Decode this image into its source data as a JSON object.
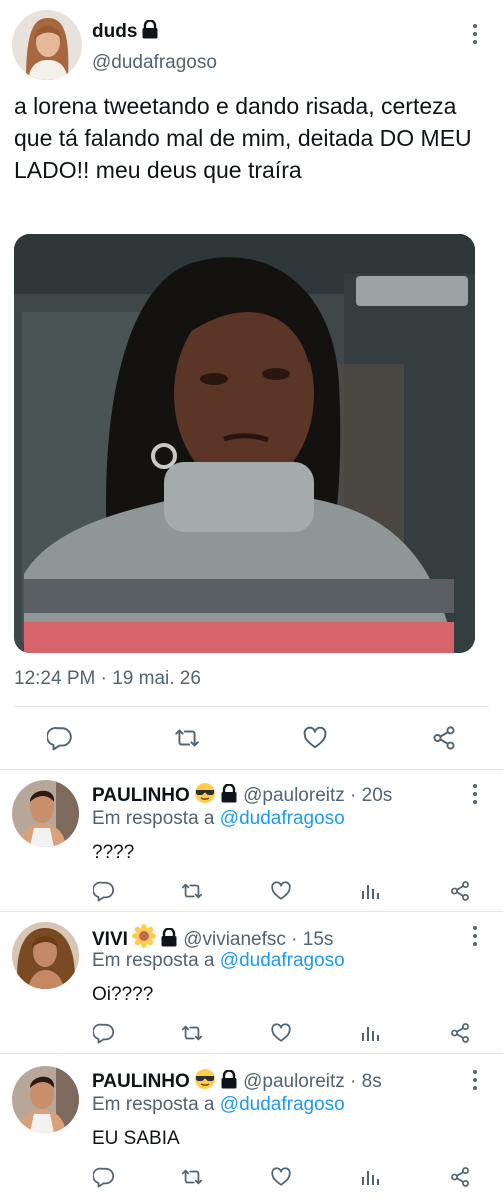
{
  "main_tweet": {
    "display_name": "duds",
    "handle": "@dudafragoso",
    "text": "a lorena tweetando e dando risada, certeza que tá falando mal de mim, deitada DO MEU LADO!! meu deus que traíra",
    "timestamp": "12:24 PM · 19 mai. 26",
    "protected": true
  },
  "replies": [
    {
      "display_name": "PAULINHO",
      "emoji": "sunglasses-emoji",
      "handle": "@pauloreitz",
      "time": " · 20s",
      "reply_prefix": "Em resposta a ",
      "reply_to": "@dudafragoso",
      "text": "????"
    },
    {
      "display_name": "VIVI",
      "emoji": "sunflower-emoji",
      "handle": "@vivianefsc",
      "time": " · 15s",
      "reply_prefix": "Em resposta a ",
      "reply_to": "@dudafragoso",
      "text": "Oi????"
    },
    {
      "display_name": "PAULINHO",
      "emoji": "sunglasses-emoji",
      "handle": "@pauloreitz",
      "time": " · 8s",
      "reply_prefix": "Em resposta a ",
      "reply_to": "@dudafragoso",
      "text": "EU SABIA"
    }
  ],
  "icons": {
    "reply": "reply-icon",
    "retweet": "retweet-icon",
    "like": "heart-icon",
    "views": "analytics-icon",
    "share": "share-icon",
    "lock": "lock-icon",
    "more": "more-icon"
  },
  "colors": {
    "text": "#0f1419",
    "secondary": "#536471",
    "link": "#1d9bf0",
    "divider": "#e1e6ea"
  }
}
